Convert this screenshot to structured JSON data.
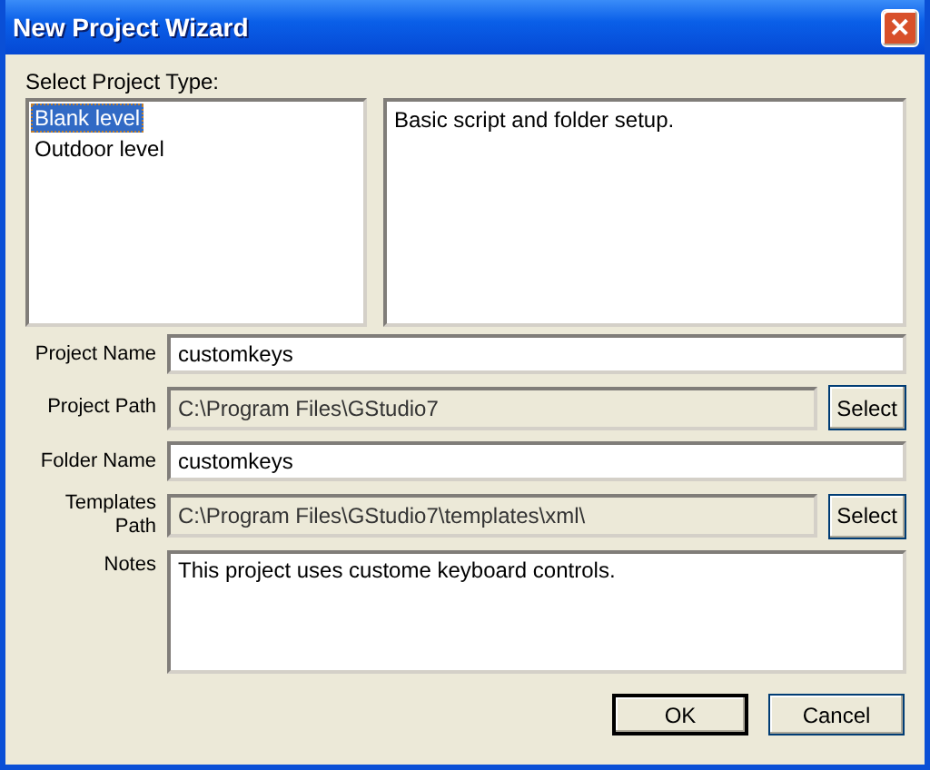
{
  "window": {
    "title": "New Project Wizard",
    "close": "✕"
  },
  "project_type": {
    "label": "Select Project Type:",
    "items": [
      {
        "label": "Blank level",
        "selected": true
      },
      {
        "label": "Outdoor level",
        "selected": false
      }
    ],
    "description": "Basic script and folder setup."
  },
  "fields": [
    {
      "label": "Project Name",
      "value": "customkeys",
      "kind": "text"
    },
    {
      "label": "Project Path",
      "value": "C:\\Program Files\\GStudio7",
      "kind": "readonly",
      "button": "Select"
    },
    {
      "label": "Folder Name",
      "value": "customkeys",
      "kind": "text"
    },
    {
      "label": "Templates Path",
      "value": "C:\\Program Files\\GStudio7\\templates\\xml\\",
      "kind": "readonly",
      "button": "Select"
    },
    {
      "label": "Notes",
      "value": "This project uses custome keyboard controls.",
      "kind": "multiline"
    }
  ],
  "buttons": [
    {
      "label": "OK",
      "default": true
    },
    {
      "label": "Cancel",
      "default": false
    }
  ]
}
